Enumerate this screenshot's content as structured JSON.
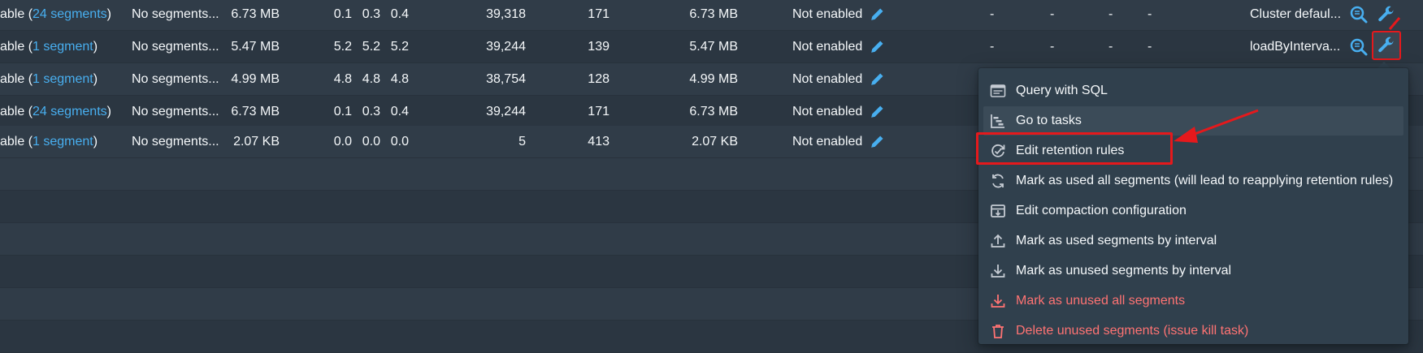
{
  "rows": [
    {
      "avail_prefix": "able (",
      "segments_link": "24 segments",
      "avail_suffix": ")",
      "unavailable": "No segments...",
      "total_size": "6.73 MB",
      "seg_min": "0.1",
      "seg_avg": "0.3",
      "seg_max": "0.4",
      "total_rows": "39,318",
      "avg_row_size": "171",
      "replicated_size": "6.73 MB",
      "compaction": "Not enabled",
      "dash1": "-",
      "dash2": "-",
      "dash3": "-",
      "dash4": "-",
      "retention": "Cluster defaul..."
    },
    {
      "avail_prefix": "able (",
      "segments_link": "1 segment",
      "avail_suffix": ")",
      "unavailable": "No segments...",
      "total_size": "5.47 MB",
      "seg_min": "5.2",
      "seg_avg": "5.2",
      "seg_max": "5.2",
      "total_rows": "39,244",
      "avg_row_size": "139",
      "replicated_size": "5.47 MB",
      "compaction": "Not enabled",
      "dash1": "-",
      "dash2": "-",
      "dash3": "-",
      "dash4": "-",
      "retention": "loadByInterva..."
    },
    {
      "avail_prefix": "able (",
      "segments_link": "1 segment",
      "avail_suffix": ")",
      "unavailable": "No segments...",
      "total_size": "4.99 MB",
      "seg_min": "4.8",
      "seg_avg": "4.8",
      "seg_max": "4.8",
      "total_rows": "38,754",
      "avg_row_size": "128",
      "replicated_size": "4.99 MB",
      "compaction": "Not enabled"
    },
    {
      "avail_prefix": "able (",
      "segments_link": "24 segments",
      "avail_suffix": ")",
      "unavailable": "No segments...",
      "total_size": "6.73 MB",
      "seg_min": "0.1",
      "seg_avg": "0.3",
      "seg_max": "0.4",
      "total_rows": "39,244",
      "avg_row_size": "171",
      "replicated_size": "6.73 MB",
      "compaction": "Not enabled"
    },
    {
      "avail_prefix": "able (",
      "segments_link": "1 segment",
      "avail_suffix": ")",
      "unavailable": "No segments...",
      "total_size": "2.07 KB",
      "seg_min": "0.0",
      "seg_avg": "0.0",
      "seg_max": "0.0",
      "total_rows": "5",
      "avg_row_size": "413",
      "replicated_size": "2.07 KB",
      "compaction": "Not enabled"
    }
  ],
  "menu": {
    "items": [
      {
        "label": "Query with SQL",
        "icon": "application-icon"
      },
      {
        "label": "Go to tasks",
        "icon": "gantt-chart-icon"
      },
      {
        "label": "Edit retention rules",
        "icon": "automatic-updates-icon"
      },
      {
        "label": "Mark as used all segments (will lead to reapplying retention rules)",
        "icon": "refresh-icon"
      },
      {
        "label": "Edit compaction configuration",
        "icon": "compressed-icon"
      },
      {
        "label": "Mark as used segments by interval",
        "icon": "upload-icon"
      },
      {
        "label": "Mark as unused segments by interval",
        "icon": "download-icon"
      },
      {
        "label": "Mark as unused all segments",
        "icon": "download-icon",
        "danger_color": "#ff7373"
      },
      {
        "label": "Delete unused segments (issue kill task)",
        "icon": "trash-icon",
        "danger_color": "#ff7373"
      }
    ]
  },
  "colors": {
    "link": "#48aff0",
    "background": "#2f3b47",
    "menu": "#30404d",
    "annotation": "#e5191c"
  }
}
